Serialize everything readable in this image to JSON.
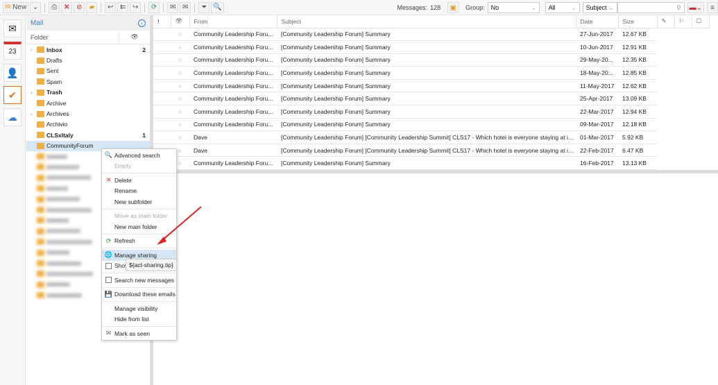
{
  "toolbar": {
    "new_label": "New",
    "messages_label": "Messages:",
    "messages_count": "128",
    "group_label": "Group:",
    "group_value": "No",
    "filter_value": "All",
    "search_field": "Subject",
    "search_placeholder": ""
  },
  "sidebar": {
    "title": "Mail",
    "folder_header": "Folder",
    "folders": [
      {
        "name": "Inbox",
        "count": "2",
        "bold": true,
        "expandable": true
      },
      {
        "name": "Drafts"
      },
      {
        "name": "Sent"
      },
      {
        "name": "Spam"
      },
      {
        "name": "Trash",
        "bold": true,
        "expandable": true
      },
      {
        "name": "Archive"
      },
      {
        "name": "Archives",
        "expandable": true
      },
      {
        "name": "Archivio"
      },
      {
        "name": "CLSxItaly",
        "count": "1",
        "bold": true
      },
      {
        "name": "CommunityForum",
        "selected": true
      }
    ],
    "blurred_count": 14
  },
  "columns": [
    "!",
    "",
    "From",
    "Subject",
    "Date",
    "Size",
    "",
    "",
    ""
  ],
  "messages": [
    {
      "from": "Community Leadership Foru...",
      "subject": "[Community Leadership Forum] Summary",
      "date": "27-Jun-2017",
      "size": "12.67 KB"
    },
    {
      "from": "Community Leadership Foru...",
      "subject": "[Community Leadership Forum] Summary",
      "date": "10-Jun-2017",
      "size": "12.91 KB"
    },
    {
      "from": "Community Leadership Foru...",
      "subject": "[Community Leadership Forum] Summary",
      "date": "29-May-20...",
      "size": "12.35 KB"
    },
    {
      "from": "Community Leadership Foru...",
      "subject": "[Community Leadership Forum] Summary",
      "date": "18-May-20...",
      "size": "12.85 KB"
    },
    {
      "from": "Community Leadership Foru...",
      "subject": "[Community Leadership Forum] Summary",
      "date": "11-May-2017",
      "size": "12.62 KB"
    },
    {
      "from": "Community Leadership Foru...",
      "subject": "[Community Leadership Forum] Summary",
      "date": "25-Apr-2017",
      "size": "13.09 KB"
    },
    {
      "from": "Community Leadership Foru...",
      "subject": "[Community Leadership Forum] Summary",
      "date": "22-Mar-2017",
      "size": "12.94 KB"
    },
    {
      "from": "Community Leadership Foru...",
      "subject": "[Community Leadership Forum] Summary",
      "date": "09-Mar-2017",
      "size": "12.18 KB"
    },
    {
      "from": "Dave",
      "subject": "[Community Leadership Forum] [Community Leadership Summit] CLS17 - Which hotel is everyone staying at in...",
      "date": "01-Mar-2017",
      "size": "5.92 KB"
    },
    {
      "from": "Dave",
      "subject": "[Community Leadership Forum] [Community Leadership Summit] CLS17 - Which hotel is everyone staying at in...",
      "date": "22-Feb-2017",
      "size": "6.47 KB"
    },
    {
      "from": "Community Leadership Foru...",
      "subject": "[Community Leadership Forum] Summary",
      "date": "16-Feb-2017",
      "size": "13.13 KB"
    }
  ],
  "context_menu": [
    {
      "label": "Advanced search",
      "icon": "search-folder"
    },
    {
      "label": "Empty",
      "disabled": true
    },
    {
      "sep": true
    },
    {
      "label": "Delete",
      "icon": "delete"
    },
    {
      "label": "Rename"
    },
    {
      "label": "New subfolder"
    },
    {
      "sep": true
    },
    {
      "label": "Move as main folder",
      "disabled": true
    },
    {
      "label": "New main folder"
    },
    {
      "sep": true
    },
    {
      "label": "Refresh",
      "icon": "refresh"
    },
    {
      "sep": true
    },
    {
      "label": "Manage sharing",
      "icon": "globe",
      "highlighted": true
    },
    {
      "label": "Show",
      "icon": "checkbox"
    },
    {
      "sep": true
    },
    {
      "label": "Search new messages",
      "icon": "checkbox"
    },
    {
      "sep": true
    },
    {
      "label": "Download these emails",
      "icon": "save"
    },
    {
      "sep": true
    },
    {
      "label": "Manage visibility"
    },
    {
      "label": "Hide from list"
    },
    {
      "sep": true
    },
    {
      "label": "Mark as seen",
      "icon": "envelope-open"
    }
  ],
  "tooltip": "${act-sharing.tip}",
  "colors": {
    "accent": "#3a7fd0",
    "selected": "#d6e6f5",
    "arrow": "#e02020"
  }
}
